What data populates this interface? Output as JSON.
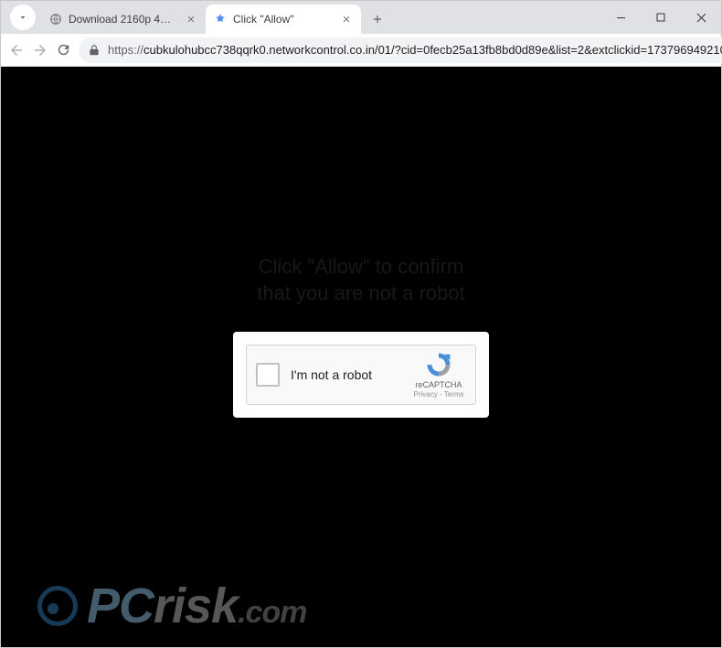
{
  "tabs": [
    {
      "title": "Download 2160p 4K YIFY Movi…",
      "active": false
    },
    {
      "title": "Click \"Allow\"",
      "active": true
    }
  ],
  "toolbar": {
    "url_protocol": "https://",
    "url_rest": "cubkulohubcc738qqrk0.networkcontrol.co.in/01/?cid=0fecb25a13fb8bd0d89e&list=2&extclickid=173796949210…"
  },
  "page": {
    "prompt_line1": "Click \"Allow\" to confirm",
    "prompt_line2": "that you are not a robot",
    "recaptcha_label": "I'm not a robot",
    "recaptcha_brand": "reCAPTCHA",
    "recaptcha_legal": "Privacy - Terms"
  },
  "watermark": {
    "pc": "PC",
    "rest": "risk",
    "com": ".com"
  }
}
